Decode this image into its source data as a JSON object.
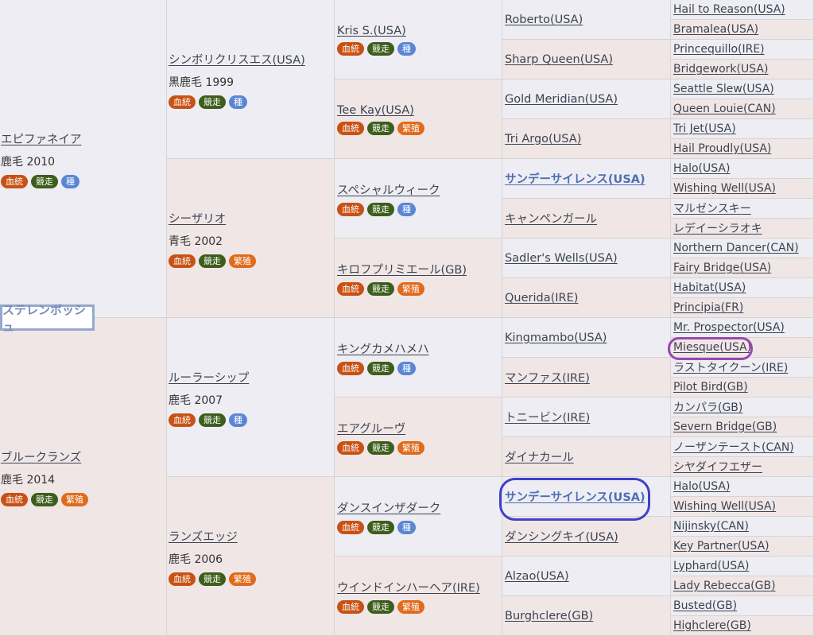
{
  "subject": {
    "name": "ステレンボッシュ"
  },
  "badge_labels": {
    "ketto": "血統",
    "kyoso": "競走",
    "shu": "種",
    "hanshoku": "繁殖"
  },
  "gen1": [
    {
      "name": "エピファネイア",
      "info": "鹿毛 2010",
      "badge3": "種"
    },
    {
      "name": "ブルークランズ",
      "info": "鹿毛 2014",
      "badge3": "繁殖"
    }
  ],
  "gen2": [
    {
      "name": "シンボリクリスエス(USA)",
      "info": "黒鹿毛 1999",
      "badge3": "種"
    },
    {
      "name": "シーザリオ",
      "info": "青毛 2002",
      "badge3": "繁殖"
    },
    {
      "name": "ルーラーシップ",
      "info": "鹿毛 2007",
      "badge3": "種"
    },
    {
      "name": "ランズエッジ",
      "info": "鹿毛 2006",
      "badge3": "繁殖"
    }
  ],
  "gen3": [
    {
      "name": "Kris S.(USA)",
      "badge3": "種"
    },
    {
      "name": "Tee Kay(USA)",
      "badge3": "繁殖"
    },
    {
      "name": "スペシャルウィーク",
      "badge3": "種"
    },
    {
      "name": "キロフプリミエール(GB)",
      "badge3": "繁殖"
    },
    {
      "name": "キングカメハメハ",
      "badge3": "種"
    },
    {
      "name": "エアグルーヴ",
      "badge3": "繁殖"
    },
    {
      "name": "ダンスインザダーク",
      "badge3": "種"
    },
    {
      "name": "ウインドインハーヘア(IRE)",
      "badge3": "繁殖"
    }
  ],
  "gen4": [
    "Roberto(USA)",
    "Sharp Queen(USA)",
    "Gold Meridian(USA)",
    "Tri Argo(USA)",
    "サンデーサイレンス(USA)",
    "キャンペンガール",
    "Sadler's Wells(USA)",
    "Querida(IRE)",
    "Kingmambo(USA)",
    "マンファス(IRE)",
    "トニービン(IRE)",
    "ダイナカール",
    "サンデーサイレンス(USA)",
    "ダンシングキイ(USA)",
    "Alzao(USA)",
    "Burghclere(GB)"
  ],
  "gen5": [
    "Hail to Reason(USA)",
    "Bramalea(USA)",
    "Princequillo(IRE)",
    "Bridgework(USA)",
    "Seattle Slew(USA)",
    "Queen Louie(CAN)",
    "Tri Jet(USA)",
    "Hail Proudly(USA)",
    "Halo(USA)",
    "Wishing Well(USA)",
    "マルゼンスキー",
    "レデイーシラオキ",
    "Northern Dancer(CAN)",
    "Fairy Bridge(USA)",
    "Habitat(USA)",
    "Principia(FR)",
    "Mr. Prospector(USA)",
    "Miesque(USA)",
    "ラストタイクーン(IRE)",
    "Pilot Bird(GB)",
    "カンパラ(GB)",
    "Severn Bridge(GB)",
    "ノーザンテースト(CAN)",
    "シヤダイフエザー",
    "Halo(USA)",
    "Wishing Well(USA)",
    "Nijinsky(CAN)",
    "Key Partner(USA)",
    "Lyphard(USA)",
    "Lady Rebecca(GB)",
    "Busted(GB)",
    "Highclere(GB)"
  ]
}
